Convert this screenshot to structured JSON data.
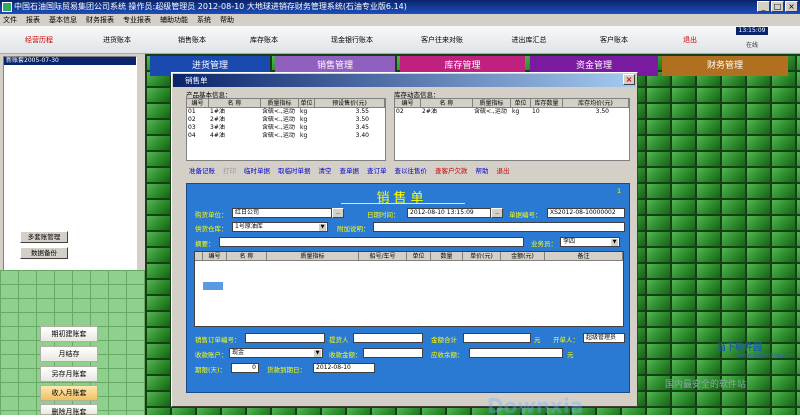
{
  "window": {
    "title": "中国石油国际贸易集团公司系统   操作员:超级管理员    2012-08-10  大地球进销存财务管理系统(石油专业版6.14)"
  },
  "menu": [
    "文件",
    "报表",
    "基本信息",
    "财务报表",
    "专业报表",
    "辅助功能",
    "系统",
    "帮助"
  ],
  "toolbar": [
    "经营历程",
    "进货账本",
    "销售账本",
    "库存账本",
    "现金银行账本",
    "客户往来对账",
    "进出库汇总",
    "客户账本",
    "退出"
  ],
  "clock": "13:15:09",
  "status_tag": "在线",
  "account_list": [
    "新账套2005-07-30"
  ],
  "left_buttons": {
    "multi": "多套账管理",
    "backup": "数据备份"
  },
  "side_nav": [
    "期初建账套",
    "月结存",
    "另存月账套",
    "收入月账套",
    "删除月账套"
  ],
  "module_tabs": [
    "进货管理",
    "销售管理",
    "库存管理",
    "资金管理",
    "财务管理"
  ],
  "dialog": {
    "title": "销售单",
    "product_section": "产品基本信息：",
    "product_headers": [
      "编号",
      "名  称",
      "质量指标",
      "单位",
      "预设售价(元)"
    ],
    "products": [
      [
        "01",
        "1#油",
        "含硫<.,运动",
        "kg",
        "3.55"
      ],
      [
        "02",
        "2#油",
        "含硫<.,运动",
        "kg",
        "3.50"
      ],
      [
        "03",
        "3#油",
        "含硫<.,运动",
        "kg",
        "3.45"
      ],
      [
        "04",
        "4#油",
        "含硫<.,运动",
        "kg",
        "3.40"
      ]
    ],
    "stock_section": "库存动态信息：",
    "stock_headers": [
      "编号",
      "名  称",
      "质量指标",
      "单位",
      "库存数量",
      "库存均价(元)"
    ],
    "stock": [
      [
        "02",
        "2#油",
        "含硫<.,运动",
        "kg",
        "10",
        "3.50"
      ]
    ],
    "buttons": [
      "准备记账",
      "打印",
      "临时单据",
      "取临时单据",
      "清空",
      "查单据",
      "查订单",
      "查以往售价",
      "查客户欠款",
      "帮助",
      "退出"
    ],
    "form": {
      "title": "销售单",
      "corner_mark": "1",
      "buyer_label": "购货单位：",
      "buyer_value": "红日公司",
      "date_label": "日期时间：",
      "date_value": "2012-08-10 13:15:09",
      "doc_no_label": "单据编号：",
      "doc_no_value": "XS2012-08-10000002",
      "warehouse_label": "供货仓库：",
      "warehouse_value": "1号原油库",
      "note_label": "附加说明：",
      "note_value": "",
      "summary_label": "摘要：",
      "summary_value": "",
      "staff_label": "业务员：",
      "staff_value": "李四",
      "detail_headers": [
        "",
        "编号",
        "名  称",
        "质量指标",
        "船号/车号",
        "单位",
        "数量",
        "单价(元)",
        "金额(元)",
        "备注"
      ],
      "order_no_label": "销售订单编号：",
      "order_no_value": "",
      "receiver_label": "提货人",
      "receiver_value": "",
      "total_label": "金额合计",
      "total_value": "",
      "yuan1": "元",
      "opener_label": "开单人：",
      "opener_value": "超级管理员",
      "account_label": "收款账户：",
      "account_value": "现金",
      "received_label": "收款金额：",
      "received_value": "",
      "due_label": "应收余额：",
      "due_value": "",
      "yuan2": "元",
      "term_label": "期限(天)：",
      "term_value": "0",
      "deadline_label": "货款到期日：",
      "deadline_value": "2012-08-10"
    },
    "watermark": "Downxia"
  },
  "brand": {
    "name": "当下软件园",
    "url": "www.DownXia.com",
    "slogan": "国内最安全的软件站"
  }
}
